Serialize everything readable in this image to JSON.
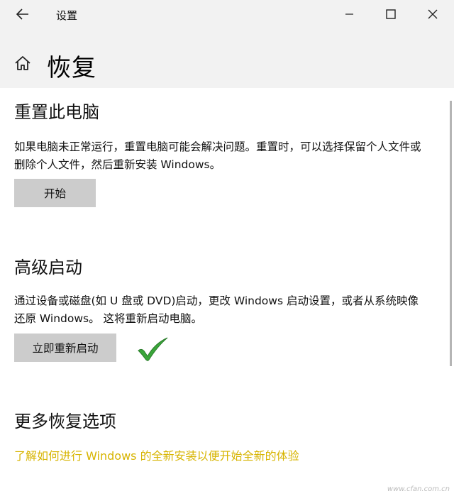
{
  "titlebar": {
    "title": "设置",
    "icons": {
      "back": "back-arrow-icon",
      "minimize": "minimize-icon",
      "maximize": "maximize-icon",
      "close": "close-icon"
    }
  },
  "header": {
    "title": "恢复",
    "icon": "home-icon"
  },
  "reset": {
    "title": "重置此电脑",
    "description": "如果电脑未正常运行，重置电脑可能会解决问题。重置时，可以选择保留个人文件或删除个人文件，然后重新安装 Windows。",
    "button": "开始"
  },
  "advanced": {
    "title": "高级启动",
    "description": "通过设备或磁盘(如 U 盘或 DVD)启动，更改 Windows 启动设置，或者从系统映像还原 Windows。 这将重新启动电脑。",
    "button": "立即重新启动"
  },
  "more": {
    "title": "更多恢复选项",
    "link": "了解如何进行 Windows 的全新安装以便开始全新的体验",
    "link_color": "#d7b400"
  },
  "annotation": {
    "icon": "green-checkmark-icon",
    "color": "#3aa63a"
  },
  "watermark": "www.cfan.com.cn"
}
